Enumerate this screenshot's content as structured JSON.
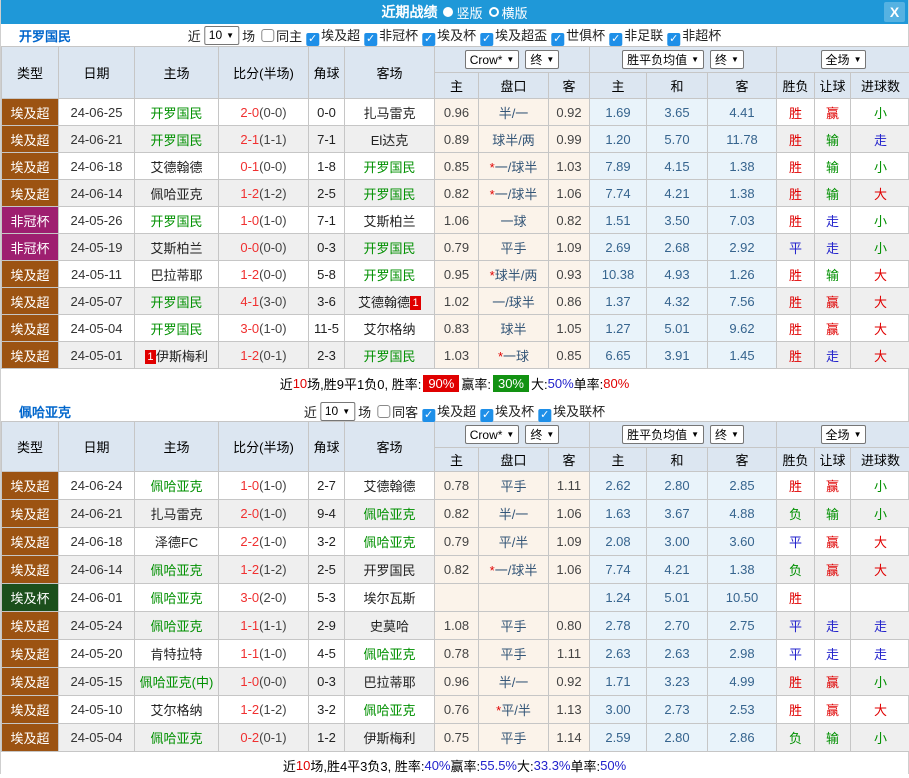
{
  "titlebar": {
    "title": "近期战绩",
    "radio_vertical": "竖版",
    "radio_horizontal": "横版",
    "close": "X"
  },
  "colors": {
    "titlebar_bg": "#1F98D8",
    "header_bg": "#DCE6F1",
    "type_colors": {
      "埃及超": "#9C5312",
      "非冠杯": "#9E1F70",
      "埃及杯": "#1C4F1C"
    },
    "team_green": "#009000",
    "win_red": "#E00000",
    "draw_blue": "#2222CC",
    "lose_green": "#009000"
  },
  "result_colors": {
    "胜": "r",
    "平": "b",
    "负": "g",
    "赢": "r",
    "输": "g",
    "走": "b",
    "大": "r",
    "小": "g"
  },
  "header": {
    "cols": [
      "类型",
      "日期",
      "主场",
      "比分(半场)",
      "角球",
      "客场"
    ],
    "subs": [
      "主",
      "盘口",
      "客",
      "主",
      "和",
      "客",
      "胜负",
      "让球",
      "进球数"
    ],
    "dropdowns": {
      "odds": "Crow*",
      "odds_final": "终",
      "avg": "胜平负均值",
      "avg_final": "终",
      "scope": "全场"
    }
  },
  "filter_labels": {
    "prefix": "近",
    "suffix": "场"
  },
  "sections": [
    {
      "team": "开罗国民",
      "filter": {
        "count": "10",
        "same_label": "同主",
        "same_checked": false,
        "leagues": [
          "埃及超",
          "非冠杯",
          "埃及杯",
          "埃及超盃",
          "世俱杯",
          "非足联",
          "非超杯"
        ]
      },
      "rows": [
        {
          "type": "埃及超",
          "date": "24-06-25",
          "home": "开罗国民",
          "hg": 1,
          "hb": "",
          "score": "2-0",
          "half": "(0-0)",
          "corner": "0-0",
          "away": "扎马雷克",
          "ag": 0,
          "ab": "",
          "o1": "0.96",
          "star": 0,
          "hc": "半/一",
          "o2": "0.92",
          "a1": "1.69",
          "a2": "3.65",
          "a3": "4.41",
          "r1": "胜",
          "r2": "赢",
          "r3": "小"
        },
        {
          "type": "埃及超",
          "date": "24-06-21",
          "home": "开罗国民",
          "hg": 1,
          "hb": "",
          "score": "2-1",
          "half": "(1-1)",
          "corner": "7-1",
          "away": "El达克",
          "ag": 0,
          "ab": "",
          "o1": "0.89",
          "star": 0,
          "hc": "球半/两",
          "o2": "0.99",
          "a1": "1.20",
          "a2": "5.70",
          "a3": "11.78",
          "r1": "胜",
          "r2": "输",
          "r3": "走"
        },
        {
          "type": "埃及超",
          "date": "24-06-18",
          "home": "艾德翰德",
          "hg": 0,
          "hb": "",
          "score": "0-1",
          "half": "(0-0)",
          "corner": "1-8",
          "away": "开罗国民",
          "ag": 1,
          "ab": "",
          "o1": "0.85",
          "star": 1,
          "hc": "一/球半",
          "o2": "1.03",
          "a1": "7.89",
          "a2": "4.15",
          "a3": "1.38",
          "r1": "胜",
          "r2": "输",
          "r3": "小"
        },
        {
          "type": "埃及超",
          "date": "24-06-14",
          "home": "佩哈亚克",
          "hg": 0,
          "hb": "",
          "score": "1-2",
          "half": "(1-2)",
          "corner": "2-5",
          "away": "开罗国民",
          "ag": 1,
          "ab": "",
          "o1": "0.82",
          "star": 1,
          "hc": "一/球半",
          "o2": "1.06",
          "a1": "7.74",
          "a2": "4.21",
          "a3": "1.38",
          "r1": "胜",
          "r2": "输",
          "r3": "大"
        },
        {
          "type": "非冠杯",
          "date": "24-05-26",
          "home": "开罗国民",
          "hg": 1,
          "hb": "",
          "score": "1-0",
          "half": "(1-0)",
          "corner": "7-1",
          "away": "艾斯柏兰",
          "ag": 0,
          "ab": "",
          "o1": "1.06",
          "star": 0,
          "hc": "一球",
          "o2": "0.82",
          "a1": "1.51",
          "a2": "3.50",
          "a3": "7.03",
          "r1": "胜",
          "r2": "走",
          "r3": "小"
        },
        {
          "type": "非冠杯",
          "date": "24-05-19",
          "home": "艾斯柏兰",
          "hg": 0,
          "hb": "",
          "score": "0-0",
          "half": "(0-0)",
          "corner": "0-3",
          "away": "开罗国民",
          "ag": 1,
          "ab": "",
          "o1": "0.79",
          "star": 0,
          "hc": "平手",
          "o2": "1.09",
          "a1": "2.69",
          "a2": "2.68",
          "a3": "2.92",
          "r1": "平",
          "r2": "走",
          "r3": "小"
        },
        {
          "type": "埃及超",
          "date": "24-05-11",
          "home": "巴拉蒂耶",
          "hg": 0,
          "hb": "",
          "score": "1-2",
          "half": "(0-0)",
          "corner": "5-8",
          "away": "开罗国民",
          "ag": 1,
          "ab": "",
          "o1": "0.95",
          "star": 1,
          "hc": "球半/两",
          "o2": "0.93",
          "a1": "10.38",
          "a2": "4.93",
          "a3": "1.26",
          "r1": "胜",
          "r2": "输",
          "r3": "大"
        },
        {
          "type": "埃及超",
          "date": "24-05-07",
          "home": "开罗国民",
          "hg": 1,
          "hb": "",
          "score": "4-1",
          "half": "(3-0)",
          "corner": "3-6",
          "away": "艾德翰德",
          "ag": 0,
          "ab": "1",
          "o1": "1.02",
          "star": 0,
          "hc": "一/球半",
          "o2": "0.86",
          "a1": "1.37",
          "a2": "4.32",
          "a3": "7.56",
          "r1": "胜",
          "r2": "赢",
          "r3": "大"
        },
        {
          "type": "埃及超",
          "date": "24-05-04",
          "home": "开罗国民",
          "hg": 1,
          "hb": "",
          "score": "3-0",
          "half": "(1-0)",
          "corner": "11-5",
          "away": "艾尔格纳",
          "ag": 0,
          "ab": "",
          "o1": "0.83",
          "star": 0,
          "hc": "球半",
          "o2": "1.05",
          "a1": "1.27",
          "a2": "5.01",
          "a3": "9.62",
          "r1": "胜",
          "r2": "赢",
          "r3": "大"
        },
        {
          "type": "埃及超",
          "date": "24-05-01",
          "home": "伊斯梅利",
          "hg": 0,
          "hb": "1",
          "score": "1-2",
          "half": "(0-1)",
          "corner": "2-3",
          "away": "开罗国民",
          "ag": 1,
          "ab": "",
          "o1": "1.03",
          "star": 1,
          "hc": "一球",
          "o2": "0.85",
          "a1": "6.65",
          "a2": "3.91",
          "a3": "1.45",
          "r1": "胜",
          "r2": "走",
          "r3": "大"
        }
      ],
      "summary": [
        {
          "t": "近"
        },
        {
          "t": "10",
          "c": "red"
        },
        {
          "t": "场,胜9平1负0, 胜率: "
        },
        {
          "t": "90%",
          "c": "badge-red"
        },
        {
          "t": " 赢率: "
        },
        {
          "t": "30%",
          "c": "badge-green"
        },
        {
          "t": " 大:"
        },
        {
          "t": "50%",
          "c": "blue"
        },
        {
          "t": " 单率:"
        },
        {
          "t": "80%",
          "c": "red"
        }
      ]
    },
    {
      "team": "佩哈亚克",
      "filter": {
        "count": "10",
        "same_label": "同客",
        "same_checked": false,
        "leagues": [
          "埃及超",
          "埃及杯",
          "埃及联杯"
        ]
      },
      "rows": [
        {
          "type": "埃及超",
          "date": "24-06-24",
          "home": "佩哈亚克",
          "hg": 1,
          "hb": "",
          "score": "1-0",
          "half": "(1-0)",
          "corner": "2-7",
          "away": "艾德翰德",
          "ag": 0,
          "ab": "",
          "o1": "0.78",
          "star": 0,
          "hc": "平手",
          "o2": "1.11",
          "a1": "2.62",
          "a2": "2.80",
          "a3": "2.85",
          "r1": "胜",
          "r2": "赢",
          "r3": "小"
        },
        {
          "type": "埃及超",
          "date": "24-06-21",
          "home": "扎马雷克",
          "hg": 0,
          "hb": "",
          "score": "2-0",
          "half": "(1-0)",
          "corner": "9-4",
          "away": "佩哈亚克",
          "ag": 1,
          "ab": "",
          "o1": "0.82",
          "star": 0,
          "hc": "半/一",
          "o2": "1.06",
          "a1": "1.63",
          "a2": "3.67",
          "a3": "4.88",
          "r1": "负",
          "r2": "输",
          "r3": "小"
        },
        {
          "type": "埃及超",
          "date": "24-06-18",
          "home": "泽德FC",
          "hg": 0,
          "hb": "",
          "score": "2-2",
          "half": "(1-0)",
          "corner": "3-2",
          "away": "佩哈亚克",
          "ag": 1,
          "ab": "",
          "o1": "0.79",
          "star": 0,
          "hc": "平/半",
          "o2": "1.09",
          "a1": "2.08",
          "a2": "3.00",
          "a3": "3.60",
          "r1": "平",
          "r2": "赢",
          "r3": "大"
        },
        {
          "type": "埃及超",
          "date": "24-06-14",
          "home": "佩哈亚克",
          "hg": 1,
          "hb": "",
          "score": "1-2",
          "half": "(1-2)",
          "corner": "2-5",
          "away": "开罗国民",
          "ag": 0,
          "ab": "",
          "o1": "0.82",
          "star": 1,
          "hc": "一/球半",
          "o2": "1.06",
          "a1": "7.74",
          "a2": "4.21",
          "a3": "1.38",
          "r1": "负",
          "r2": "赢",
          "r3": "大"
        },
        {
          "type": "埃及杯",
          "date": "24-06-01",
          "home": "佩哈亚克",
          "hg": 1,
          "hb": "",
          "score": "3-0",
          "half": "(2-0)",
          "corner": "5-3",
          "away": "埃尔瓦斯",
          "ag": 0,
          "ab": "",
          "o1": "",
          "star": 0,
          "hc": "",
          "o2": "",
          "a1": "1.24",
          "a2": "5.01",
          "a3": "10.50",
          "r1": "胜",
          "r2": "",
          "r3": ""
        },
        {
          "type": "埃及超",
          "date": "24-05-24",
          "home": "佩哈亚克",
          "hg": 1,
          "hb": "",
          "score": "1-1",
          "half": "(1-1)",
          "corner": "2-9",
          "away": "史莫哈",
          "ag": 0,
          "ab": "",
          "o1": "1.08",
          "star": 0,
          "hc": "平手",
          "o2": "0.80",
          "a1": "2.78",
          "a2": "2.70",
          "a3": "2.75",
          "r1": "平",
          "r2": "走",
          "r3": "走"
        },
        {
          "type": "埃及超",
          "date": "24-05-20",
          "home": "肯特拉特",
          "hg": 0,
          "hb": "",
          "score": "1-1",
          "half": "(1-0)",
          "corner": "4-5",
          "away": "佩哈亚克",
          "ag": 1,
          "ab": "",
          "o1": "0.78",
          "star": 0,
          "hc": "平手",
          "o2": "1.11",
          "a1": "2.63",
          "a2": "2.63",
          "a3": "2.98",
          "r1": "平",
          "r2": "走",
          "r3": "走"
        },
        {
          "type": "埃及超",
          "date": "24-05-15",
          "home": "佩哈亚克(中)",
          "hg": 1,
          "hb": "",
          "score": "1-0",
          "half": "(0-0)",
          "corner": "0-3",
          "away": "巴拉蒂耶",
          "ag": 0,
          "ab": "",
          "o1": "0.96",
          "star": 0,
          "hc": "半/一",
          "o2": "0.92",
          "a1": "1.71",
          "a2": "3.23",
          "a3": "4.99",
          "r1": "胜",
          "r2": "赢",
          "r3": "小"
        },
        {
          "type": "埃及超",
          "date": "24-05-10",
          "home": "艾尔格纳",
          "hg": 0,
          "hb": "",
          "score": "1-2",
          "half": "(1-2)",
          "corner": "3-2",
          "away": "佩哈亚克",
          "ag": 1,
          "ab": "",
          "o1": "0.76",
          "star": 1,
          "hc": "平/半",
          "o2": "1.13",
          "a1": "3.00",
          "a2": "2.73",
          "a3": "2.53",
          "r1": "胜",
          "r2": "赢",
          "r3": "大"
        },
        {
          "type": "埃及超",
          "date": "24-05-04",
          "home": "佩哈亚克",
          "hg": 1,
          "hb": "",
          "score": "0-2",
          "half": "(0-1)",
          "corner": "1-2",
          "away": "伊斯梅利",
          "ag": 0,
          "ab": "",
          "o1": "0.75",
          "star": 0,
          "hc": "平手",
          "o2": "1.14",
          "a1": "2.59",
          "a2": "2.80",
          "a3": "2.86",
          "r1": "负",
          "r2": "输",
          "r3": "小"
        }
      ],
      "summary": [
        {
          "t": "近"
        },
        {
          "t": "10",
          "c": "red"
        },
        {
          "t": "场,胜4平3负3, 胜率:"
        },
        {
          "t": "40%",
          "c": "blue"
        },
        {
          "t": " 赢率:"
        },
        {
          "t": "55.5%",
          "c": "blue"
        },
        {
          "t": " 大:"
        },
        {
          "t": "33.3%",
          "c": "blue"
        },
        {
          "t": " 单率:"
        },
        {
          "t": "50%",
          "c": "blue"
        }
      ]
    }
  ]
}
